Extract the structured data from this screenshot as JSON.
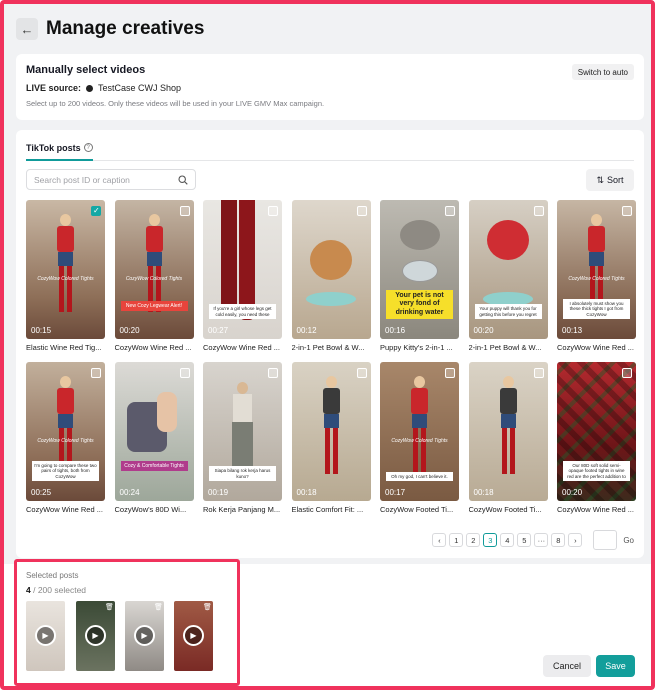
{
  "header": {
    "title": "Manage creatives",
    "back_icon": "arrow-left-icon"
  },
  "manual": {
    "title": "Manually select videos",
    "live_label": "LIVE source:",
    "shop_name": "TestCase CWJ Shop",
    "hint": "Select up to 200 videos. Only these videos will be used in your LIVE GMV Max campaign.",
    "switch_label": "Switch to auto"
  },
  "tabs": [
    {
      "label": "TikTok posts",
      "active": true
    }
  ],
  "search": {
    "placeholder": "Search post ID or caption",
    "value": ""
  },
  "sort": {
    "label": "Sort"
  },
  "posts": [
    {
      "name": "Elastic Wine Red Tig...",
      "duration": "00:15",
      "checked": true,
      "caption": "",
      "watermark": "CozyWow Colored Tights"
    },
    {
      "name": "CozyWow Wine Red ...",
      "duration": "00:20",
      "checked": false,
      "caption": "New Cozy Legwear Alert!",
      "watermark": "CozyWow Colored Tights"
    },
    {
      "name": "CozyWow Wine Red ...",
      "duration": "00:27",
      "checked": false,
      "caption": "If you're a girl whose legs get cold easily, you need these",
      "watermark": ""
    },
    {
      "name": "2-in-1 Pet Bowl & W...",
      "duration": "00:12",
      "checked": false,
      "caption": "",
      "watermark": ""
    },
    {
      "name": "Puppy Kitty's 2-in-1 ...",
      "duration": "00:16",
      "checked": false,
      "caption": "Your pet is not very fond of drinking water",
      "watermark": ""
    },
    {
      "name": "2-in-1 Pet Bowl & W...",
      "duration": "00:20",
      "checked": false,
      "caption": "Your puppy will thank you for getting this before you regret",
      "watermark": ""
    },
    {
      "name": "CozyWow Wine Red ...",
      "duration": "00:13",
      "checked": false,
      "caption": "I absolutely must show you these thick tights I got from CozyWow",
      "watermark": "CozyWow Colored Tights"
    },
    {
      "name": "CozyWow Wine Red ...",
      "duration": "00:25",
      "checked": false,
      "caption": "I'm going to compare these two pairs of tights, both from CozyWow",
      "watermark": "CozyWow Colored Tights"
    },
    {
      "name": "CozyWow's 80D Wi...",
      "duration": "00:24",
      "checked": false,
      "caption": "Cozy & Comfortable Tights",
      "watermark": ""
    },
    {
      "name": "Rok Kerja Panjang M...",
      "duration": "00:19",
      "checked": false,
      "caption": "Siapa bilang rok kerja harus kuno?",
      "watermark": ""
    },
    {
      "name": "Elastic Comfort Fit: ...",
      "duration": "00:18",
      "checked": false,
      "caption": "",
      "watermark": ""
    },
    {
      "name": "CozyWow Footed Ti...",
      "duration": "00:17",
      "checked": false,
      "caption": "Oh my god, I can't believe it.",
      "watermark": "CozyWow Colored Tights"
    },
    {
      "name": "CozyWow Footed Ti...",
      "duration": "00:18",
      "checked": false,
      "caption": "",
      "watermark": ""
    },
    {
      "name": "CozyWow Wine Red ...",
      "duration": "00:20",
      "checked": false,
      "caption": "Our 80D soft solid semi-opaque footed tights in wine red are the perfect addition to",
      "watermark": ""
    }
  ],
  "pagination": {
    "prev_icon": "chevron-left-icon",
    "pages": [
      "1",
      "2",
      "3",
      "4",
      "5",
      "···",
      "8"
    ],
    "current": "3",
    "next_icon": "chevron-right-icon",
    "go_label": "Go"
  },
  "selected": {
    "title": "Selected posts",
    "count": "4",
    "total": " / 200 selected"
  },
  "actions": {
    "cancel": "Cancel",
    "save": "Save"
  },
  "colors": {
    "accent": "#139e9b",
    "highlight": "#f0325c"
  }
}
